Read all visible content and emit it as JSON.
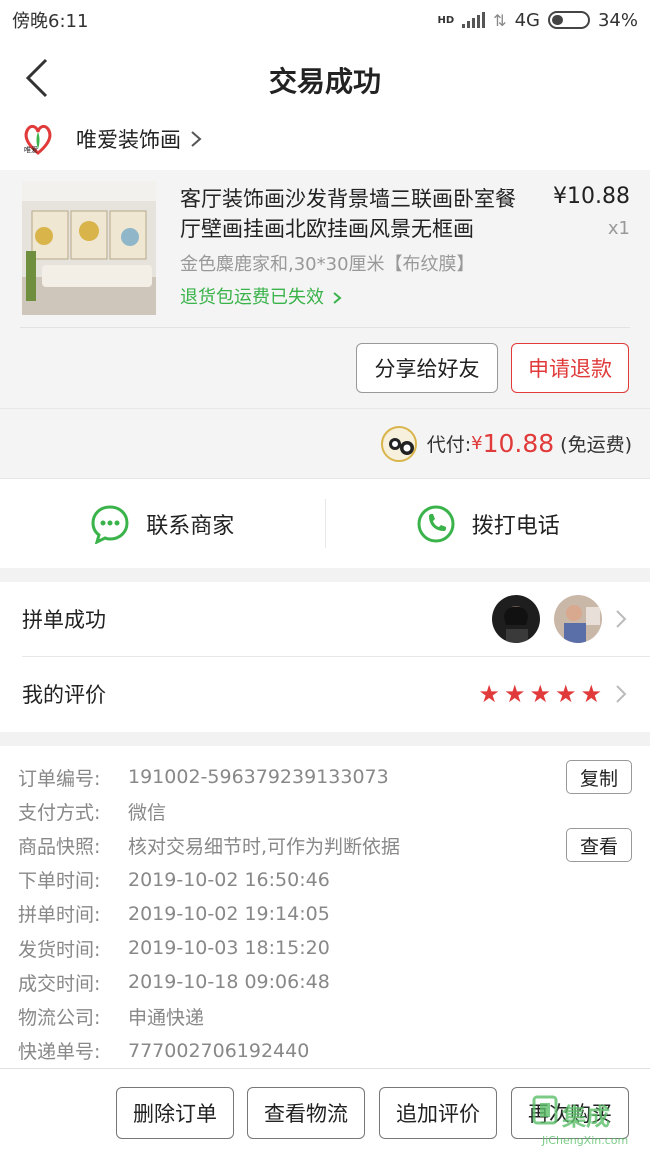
{
  "status_bar": {
    "time": "傍晚6:11",
    "network": "4G",
    "battery": "34%",
    "battery_level": 0.34,
    "hd": "HD"
  },
  "nav": {
    "title": "交易成功"
  },
  "shop": {
    "name": "唯爱装饰画",
    "logo_text": "唯爱"
  },
  "product": {
    "title": "客厅装饰画沙发背景墙三联画卧室餐厅壁画挂画北欧挂画风景无框画",
    "price": "¥10.88",
    "qty": "x1",
    "spec": "金色麋鹿家和,30*30厘米【布纹膜】",
    "insurance": "退货包运费已失效",
    "share_label": "分享给好友",
    "refund_label": "申请退款"
  },
  "payment": {
    "label": "代付:",
    "currency": "¥",
    "amount": "10.88",
    "note": "(免运费)"
  },
  "contact": {
    "merchant_label": "联系商家",
    "call_label": "拨打电话"
  },
  "group": {
    "label": "拼单成功",
    "review_label": "我的评价",
    "rating": 5
  },
  "order_info": [
    {
      "key": "订单编号:",
      "value": "191002-596379239133073",
      "action": "复制"
    },
    {
      "key": "支付方式:",
      "value": "微信"
    },
    {
      "key": "商品快照:",
      "value": "核对交易细节时,可作为判断依据",
      "action": "查看"
    },
    {
      "key": "下单时间:",
      "value": "2019-10-02 16:50:46"
    },
    {
      "key": "拼单时间:",
      "value": "2019-10-02 19:14:05"
    },
    {
      "key": "发货时间:",
      "value": "2019-10-03 18:15:20"
    },
    {
      "key": "成交时间:",
      "value": "2019-10-18 09:06:48"
    },
    {
      "key": "物流公司:",
      "value": "申通快递"
    },
    {
      "key": "快递单号:",
      "value": "777002706192440"
    }
  ],
  "bottom_actions": {
    "delete": "删除订单",
    "logistics": "查看物流",
    "review": "追加评价",
    "rebuy": "再次购买"
  },
  "watermark": {
    "text": "集成",
    "sub": "JiChengXin.com"
  },
  "colors": {
    "accent_red": "#e03a3a",
    "green": "#3ab34a"
  }
}
